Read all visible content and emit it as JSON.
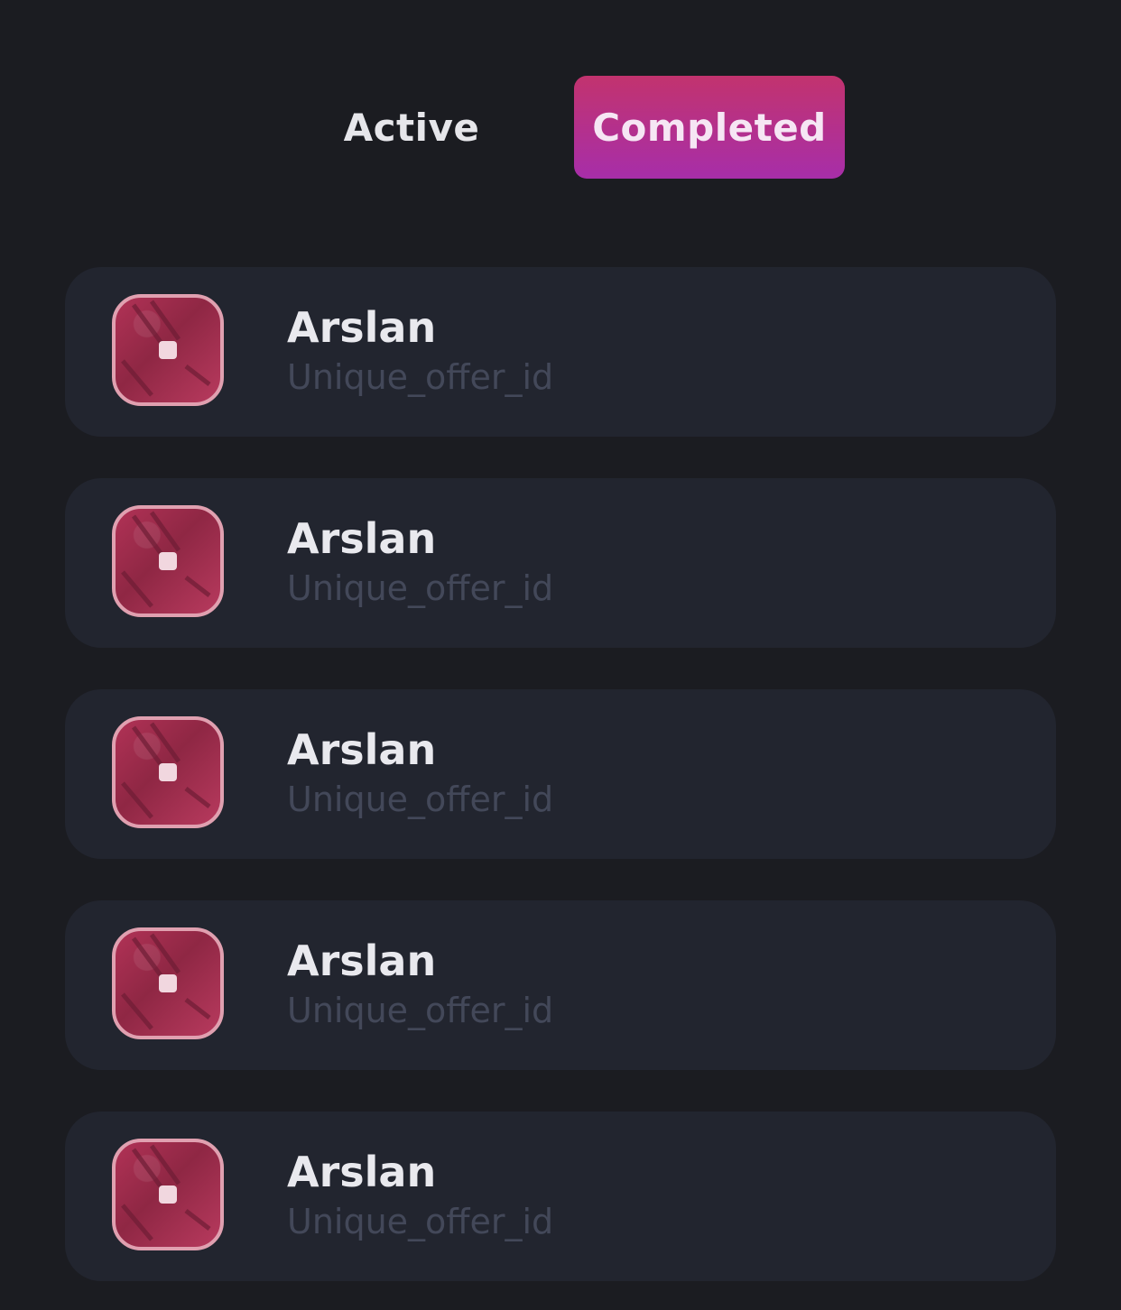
{
  "tabs": [
    {
      "label": "Active",
      "selected": false
    },
    {
      "label": "Completed",
      "selected": true
    }
  ],
  "colors": {
    "background": "#1b1c21",
    "card": "#22252f",
    "accent_start": "#c2336e",
    "accent_end": "#a72ea9"
  },
  "offers": [
    {
      "name": "Arslan",
      "offer_id": "Unique_offer_id",
      "icon": "offer-app-icon"
    },
    {
      "name": "Arslan",
      "offer_id": "Unique_offer_id",
      "icon": "offer-app-icon"
    },
    {
      "name": "Arslan",
      "offer_id": "Unique_offer_id",
      "icon": "offer-app-icon"
    },
    {
      "name": "Arslan",
      "offer_id": "Unique_offer_id",
      "icon": "offer-app-icon"
    },
    {
      "name": "Arslan",
      "offer_id": "Unique_offer_id",
      "icon": "offer-app-icon"
    }
  ]
}
